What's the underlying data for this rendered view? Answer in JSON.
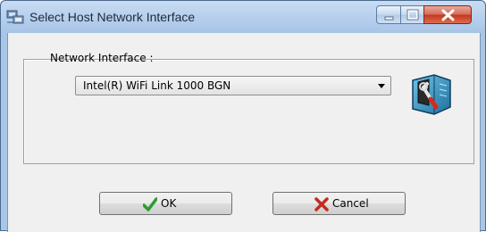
{
  "window": {
    "title": "Select Host Network Interface",
    "icon": "network-host-icon"
  },
  "titlebar_controls": {
    "minimize": "minimize-icon",
    "maximize": "maximize-icon",
    "close": "close-icon"
  },
  "form": {
    "network_interface_label": "Network Interface :",
    "network_interface_selected": "Intel(R) WiFi Link 1000 BGN",
    "settings_icon": "tools-wrench-icon"
  },
  "buttons": {
    "ok_label": "OK",
    "ok_icon": "checkmark-icon",
    "cancel_label": "Cancel",
    "cancel_icon": "x-cross-icon"
  },
  "colors": {
    "ok_check": "#2f9b2f",
    "cancel_x": "#c62a1a",
    "close_button": "#c2381e"
  }
}
